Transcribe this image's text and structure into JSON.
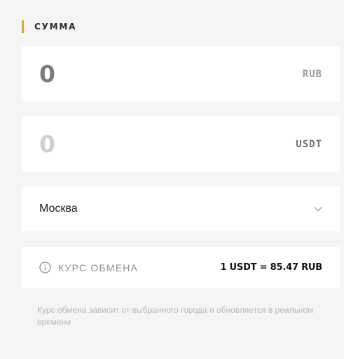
{
  "section": {
    "title": "СУММА"
  },
  "amount_rub": {
    "value": "0",
    "currency": "RUB"
  },
  "amount_usdt": {
    "value": "0",
    "currency": "USDT"
  },
  "city_select": {
    "value": "Москва"
  },
  "exchange_rate": {
    "label": "КУРС ОБМЕНА",
    "value": "1 USDT = 85.47 RUB"
  },
  "note": "Курс обмена зависит от выбранного города и обновляется в реальном времени",
  "icons": {
    "info": "info-icon",
    "chevron": "chevron-down-icon"
  },
  "colors": {
    "accent": "#e0a72a",
    "background": "#f5f5f5",
    "card": "#ffffff"
  }
}
